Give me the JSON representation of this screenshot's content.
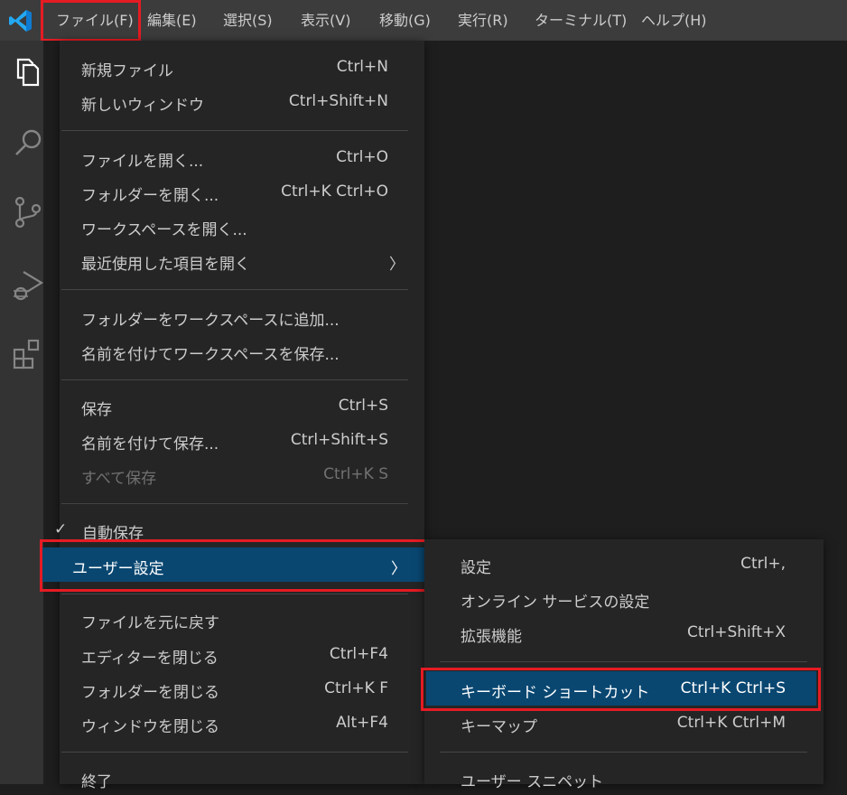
{
  "menubar": {
    "items": [
      "ファイル(F)",
      "編集(E)",
      "選択(S)",
      "表示(V)",
      "移動(G)",
      "実行(R)",
      "ターミナル(T)",
      "ヘルプ(H)"
    ]
  },
  "activity_bar": {
    "icons": [
      "explorer-icon",
      "search-icon",
      "source-control-icon",
      "run-debug-icon",
      "extensions-icon"
    ]
  },
  "file_menu": {
    "items": [
      {
        "label": "新規ファイル",
        "shortcut": "Ctrl+N"
      },
      {
        "label": "新しいウィンドウ",
        "shortcut": "Ctrl+Shift+N"
      },
      {
        "label": "ファイルを開く...",
        "shortcut": "Ctrl+O"
      },
      {
        "label": "フォルダーを開く...",
        "shortcut": "Ctrl+K Ctrl+O"
      },
      {
        "label": "ワークスペースを開く...",
        "shortcut": ""
      },
      {
        "label": "最近使用した項目を開く",
        "shortcut": ""
      },
      {
        "label": "フォルダーをワークスペースに追加...",
        "shortcut": ""
      },
      {
        "label": "名前を付けてワークスペースを保存...",
        "shortcut": ""
      },
      {
        "label": "保存",
        "shortcut": "Ctrl+S"
      },
      {
        "label": "名前を付けて保存...",
        "shortcut": "Ctrl+Shift+S"
      },
      {
        "label": "すべて保存",
        "shortcut": "Ctrl+K S"
      },
      {
        "label": "自動保存",
        "shortcut": ""
      },
      {
        "label": "ユーザー設定",
        "shortcut": ""
      },
      {
        "label": "ファイルを元に戻す",
        "shortcut": ""
      },
      {
        "label": "エディターを閉じる",
        "shortcut": "Ctrl+F4"
      },
      {
        "label": "フォルダーを閉じる",
        "shortcut": "Ctrl+K F"
      },
      {
        "label": "ウィンドウを閉じる",
        "shortcut": "Alt+F4"
      },
      {
        "label": "終了",
        "shortcut": ""
      }
    ]
  },
  "preferences_menu": {
    "items": [
      {
        "label": "設定",
        "shortcut": "Ctrl+,"
      },
      {
        "label": "オンライン サービスの設定",
        "shortcut": ""
      },
      {
        "label": "拡張機能",
        "shortcut": "Ctrl+Shift+X"
      },
      {
        "label": "キーボード ショートカット",
        "shortcut": "Ctrl+K Ctrl+S"
      },
      {
        "label": "キーマップ",
        "shortcut": "Ctrl+K Ctrl+M"
      },
      {
        "label": "ユーザー スニペット",
        "shortcut": ""
      }
    ]
  },
  "symbols": {
    "check": "✓",
    "chevron": "〉"
  },
  "colors": {
    "titlebar": "#3c3c3c",
    "activitybar": "#333333",
    "menu_bg": "#252526",
    "selection": "#094771",
    "highlight": "#e51b23",
    "logo": "#23a9f2"
  }
}
